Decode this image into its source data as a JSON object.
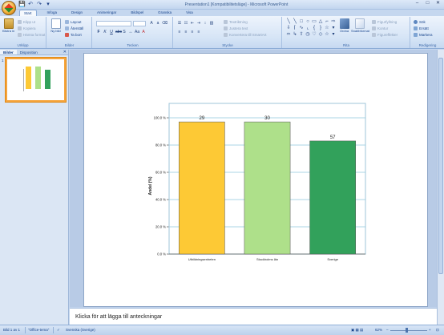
{
  "window": {
    "title": "Presentation1 [Kompatibilitetsläge] - Microsoft PowerPoint",
    "controls": [
      "–",
      "□",
      "✕"
    ]
  },
  "qat": [
    "💾",
    "↶",
    "↷",
    "▾"
  ],
  "tabs": [
    "Start",
    "Infoga",
    "Design",
    "Animeringar",
    "Bildspel",
    "Granska",
    "Visa"
  ],
  "active_tab": "Start",
  "ribbon": {
    "clipboard": {
      "paste": "Klistra in",
      "cut": "Klipp ut",
      "copy": "Kopiera",
      "format_painter": "Hämta format",
      "label": "Urklipp"
    },
    "slides": {
      "new_slide": "Ny bild",
      "layout": "Layout",
      "reset": "Återställ",
      "delete": "Ta bort",
      "label": "Bilder"
    },
    "font": {
      "family": "",
      "size": "",
      "label": "Tecken"
    },
    "paragraph": {
      "text_direction": "Textriktning",
      "align_text": "Justera text",
      "smartart": "Konvertera till SmartArt",
      "label": "Stycke"
    },
    "drawing": {
      "arrange": "Ordna",
      "quick_styles": "Snabbformat",
      "shape_fill": "Figurfyllning",
      "shape_outline": "Kontur",
      "shape_effects": "Figureffekter",
      "label": "Rita"
    },
    "editing": {
      "find": "Sök",
      "replace": "Ersätt",
      "select": "Markera",
      "label": "Redigering"
    }
  },
  "pane": {
    "tabs": [
      "Bilder",
      "Disposition"
    ],
    "slide_number": "1"
  },
  "chart_data": {
    "type": "bar",
    "categories": [
      "Utbildningsenheten",
      "Stockholms län",
      "Sverige"
    ],
    "values": [
      97,
      97,
      83
    ],
    "data_labels": [
      "29",
      "30",
      "57"
    ],
    "colors": [
      "#fdc935",
      "#aee08a",
      "#32a15b"
    ],
    "ylabel": "Andel (%)",
    "ylim": [
      0,
      100
    ],
    "yticks": [
      "0.0 %",
      "20.0 %",
      "40.0 %",
      "60.0 %",
      "80.0 %",
      "100.0 %"
    ],
    "grid": true
  },
  "notes": {
    "placeholder": "Klicka för att lägga till anteckningar"
  },
  "status": {
    "slide": "Bild 1 av 1",
    "theme": "\"Office-tema\"",
    "language": "Svenska (Sverige)",
    "zoom": "62%"
  }
}
